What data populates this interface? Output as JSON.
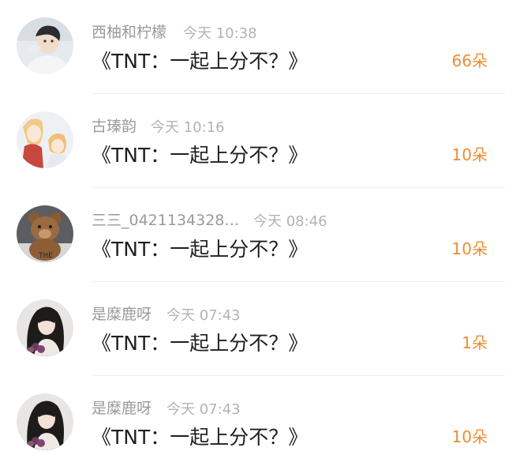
{
  "accent_color": "#f08c2f",
  "gift_records": [
    {
      "avatar_icon": "user-avatar-photo",
      "user_name": "西柚和柠檬",
      "time": "今天 10:38",
      "message": "《TNT：一起上分不？》",
      "count": "66朵"
    },
    {
      "avatar_icon": "user-avatar-photo",
      "user_name": "古瑧韵",
      "time": "今天 10:16",
      "message": "《TNT：一起上分不？》",
      "count": "10朵"
    },
    {
      "avatar_icon": "user-avatar-photo",
      "user_name": "三三_0421134328…",
      "time": "今天 08:46",
      "message": "《TNT：一起上分不？》",
      "count": "10朵"
    },
    {
      "avatar_icon": "user-avatar-photo",
      "user_name": "是糜鹿呀",
      "time": "今天 07:43",
      "message": "《TNT：一起上分不？》",
      "count": "1朵"
    },
    {
      "avatar_icon": "user-avatar-photo",
      "user_name": "是糜鹿呀",
      "time": "今天 07:43",
      "message": "《TNT：一起上分不？》",
      "count": "10朵"
    }
  ]
}
